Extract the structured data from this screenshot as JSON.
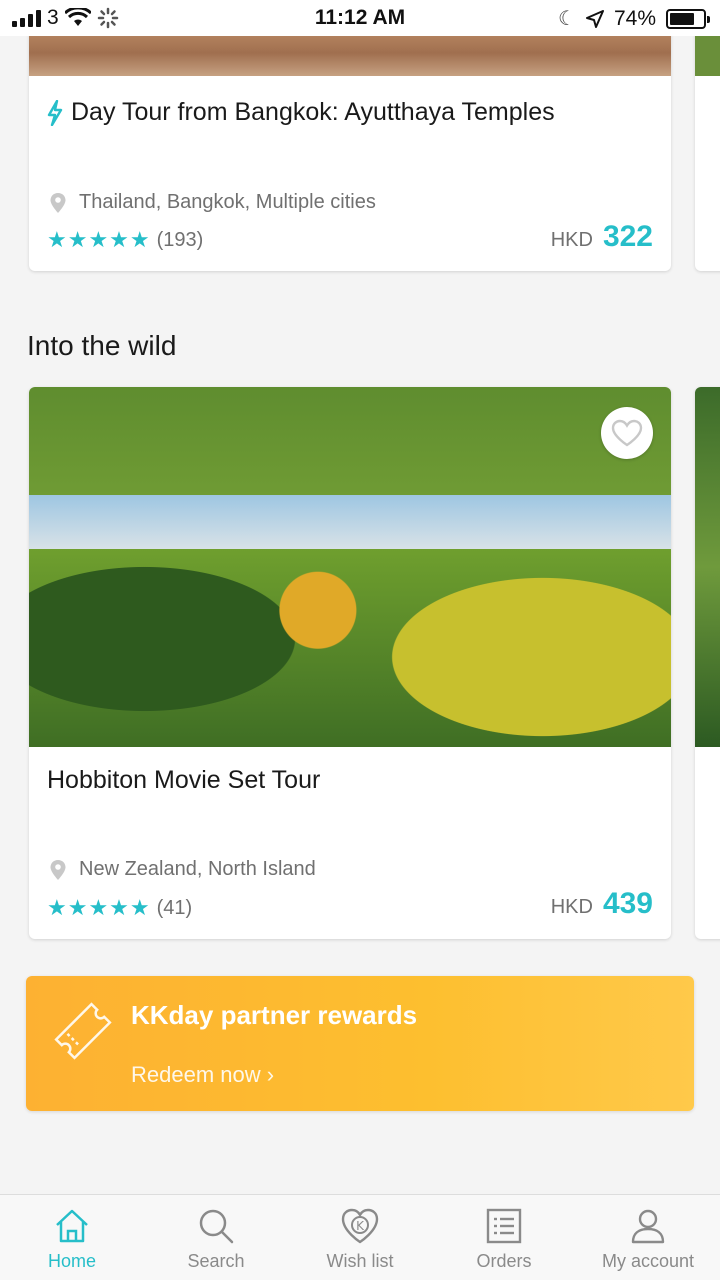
{
  "status_bar": {
    "carrier": "3",
    "time": "11:12 AM",
    "battery": "74%",
    "battery_level": 0.74
  },
  "cards": [
    {
      "title": "Day Tour from Bangkok: Ayutthaya Temples",
      "location": "Thailand, Bangkok, Multiple cities",
      "rating_count": "(193)",
      "currency": "HKD",
      "price": "322",
      "stars": "★★★★★"
    },
    {
      "title": "Hobbiton Movie Set Tour",
      "location": "New Zealand, North Island",
      "rating_count": "(41)",
      "currency": "HKD",
      "price": "439",
      "stars": "★★★★★"
    }
  ],
  "section": {
    "title": "Into the wild"
  },
  "rewards": {
    "title": "KKday partner rewards",
    "link": "Redeem now ›"
  },
  "tabs": [
    {
      "label": "Home",
      "icon": "home-icon",
      "active": true
    },
    {
      "label": "Search",
      "icon": "search-icon",
      "active": false
    },
    {
      "label": "Wish list",
      "icon": "wishlist-icon",
      "active": false
    },
    {
      "label": "Orders",
      "icon": "orders-icon",
      "active": false
    },
    {
      "label": "My account",
      "icon": "account-icon",
      "active": false
    }
  ],
  "colors": {
    "accent": "#26bec9",
    "rewards": "#fdb132"
  }
}
